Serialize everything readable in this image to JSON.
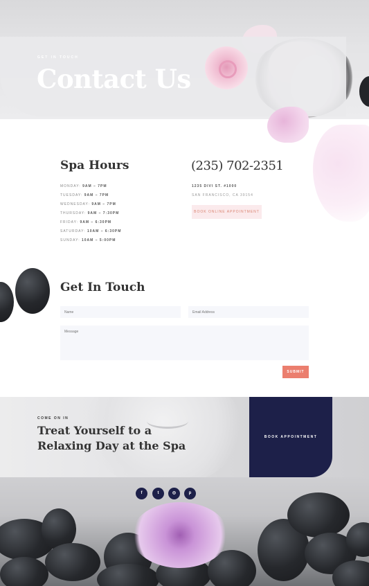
{
  "hero": {
    "eyebrow": "GET IN TOUCH",
    "title": "Contact Us"
  },
  "hours": {
    "title": "Spa Hours",
    "items": [
      {
        "day": "MONDAY:",
        "time": "9AM – 7PM"
      },
      {
        "day": "TUESDAY:",
        "time": "9AM – 7PM"
      },
      {
        "day": "WEDNESDAY:",
        "time": "9AM – 7PM"
      },
      {
        "day": "THURSDAY:",
        "time": "9AM – 7:30PM"
      },
      {
        "day": "FRIDAY:",
        "time": "9AM – 6:30PM"
      },
      {
        "day": "SATURDAY:",
        "time": "10AM – 6:30PM"
      },
      {
        "day": "SUNDAY:",
        "time": "10AM – 5:00PM"
      }
    ]
  },
  "contact": {
    "phone": "(235) 702-2351",
    "address_line1": "1235 DIVI ST. #1000",
    "address_line2": "SAN FRANCISCO, CA 39154",
    "book_online_label": "BOOK ONLINE APPOINTMENT"
  },
  "form": {
    "title": "Get In Touch",
    "name_placeholder": "Name",
    "email_placeholder": "Email Address",
    "message_placeholder": "Message",
    "submit_label": "SUBMIT"
  },
  "cta": {
    "eyebrow": "COME ON IN",
    "title": "Treat Yourself to a Relaxing Day at the Spa",
    "book_label": "BOOK APPOINTMENT"
  },
  "social": {
    "icons": [
      "facebook-icon",
      "twitter-icon",
      "instagram-icon",
      "pinterest-icon"
    ],
    "glyphs": [
      "f",
      "t",
      "◎",
      "p"
    ],
    "color": "#1d2049"
  },
  "colors": {
    "accent": "#eb7e6e",
    "navy": "#1d2049",
    "pink_button_bg": "#fbeaec"
  }
}
